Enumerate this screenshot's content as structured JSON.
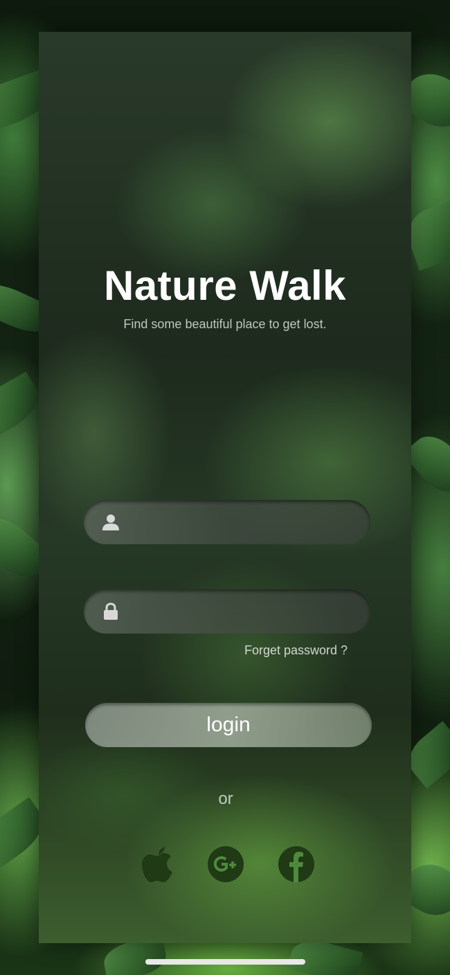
{
  "app": {
    "title": "Nature Walk",
    "subtitle": "Find some beautiful place to get lost."
  },
  "form": {
    "username": {
      "icon": "user-icon",
      "value": "",
      "placeholder": ""
    },
    "password": {
      "icon": "lock-icon",
      "value": "",
      "placeholder": ""
    },
    "forgot_label": "Forget password  ?",
    "login_label": "login",
    "divider_label": "or"
  },
  "social": [
    {
      "icon": "apple-icon"
    },
    {
      "icon": "google-plus-icon"
    },
    {
      "icon": "facebook-icon"
    }
  ],
  "colors": {
    "title": "#ffffff",
    "social_icon": "#1f3a15",
    "accent_green": "#4c8a44"
  }
}
